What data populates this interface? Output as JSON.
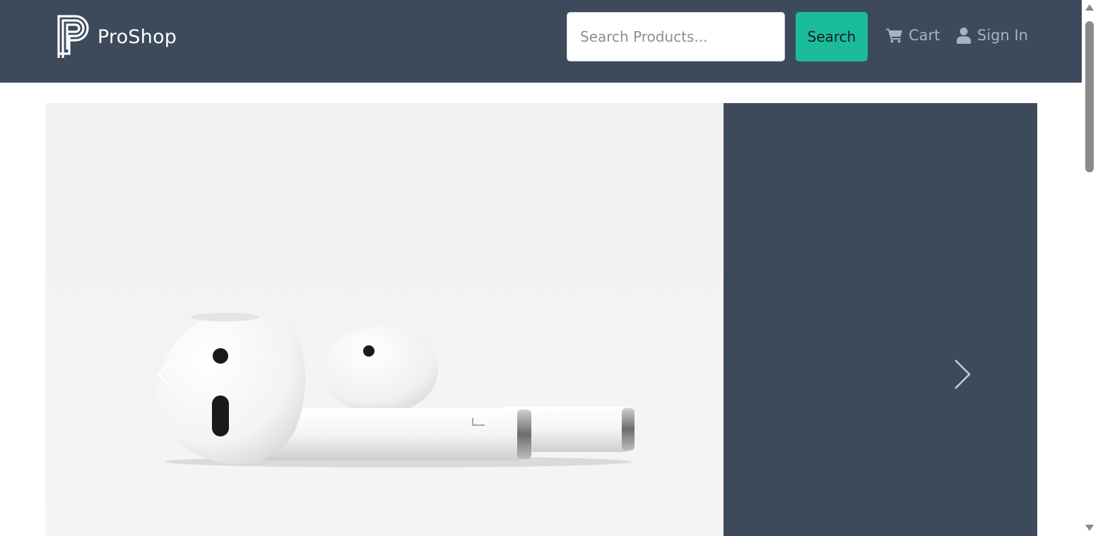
{
  "navbar": {
    "brand": {
      "logo_icon": "proshop-p-logo-icon",
      "name": "ProShop"
    },
    "search": {
      "placeholder": "Search Products...",
      "value": "",
      "button_label": "Search"
    },
    "links": {
      "cart": {
        "icon": "cart-icon",
        "label": "Cart"
      },
      "signin": {
        "icon": "user-icon",
        "label": "Sign In"
      }
    }
  },
  "carousel": {
    "slide_image": "airpods-photo",
    "prev_icon": "chevron-left-icon",
    "next_icon": "chevron-right-icon"
  },
  "colors": {
    "navbar_bg": "#3c4a5c",
    "accent": "#1abc9c",
    "nav_link": "#aab2bc",
    "carousel_bg": "#3c4a5c"
  }
}
